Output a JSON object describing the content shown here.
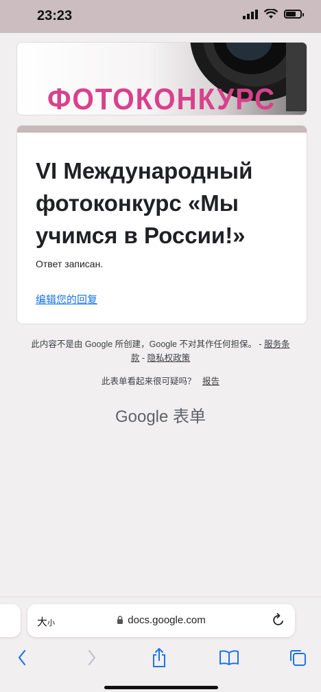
{
  "status_bar": {
    "time": "23:23"
  },
  "banner": {
    "title": "ФОТОКОНКУРС"
  },
  "form": {
    "title": "VI Международный фотоконкурс «Мы учимся в России!»",
    "confirmation": "Ответ записан.",
    "edit_link": "编辑您的回复"
  },
  "footer": {
    "disclaimer": "此内容不是由 Google 所创建，Google 不对其作任何担保。 -",
    "terms_link": "服务条款",
    "separator": "-",
    "privacy_link": "隐私权政策",
    "report_question": "此表单看起来很可疑吗？",
    "report_link": "报告",
    "brand": "Google 表单"
  },
  "browser": {
    "text_size_large": "大",
    "text_size_small": "小",
    "url": "docs.google.com"
  },
  "colors": {
    "accent": "#c9b8b9",
    "link": "#1a73e8",
    "banner_text": "#d8428a",
    "status_bar": "#cbbdc0"
  }
}
